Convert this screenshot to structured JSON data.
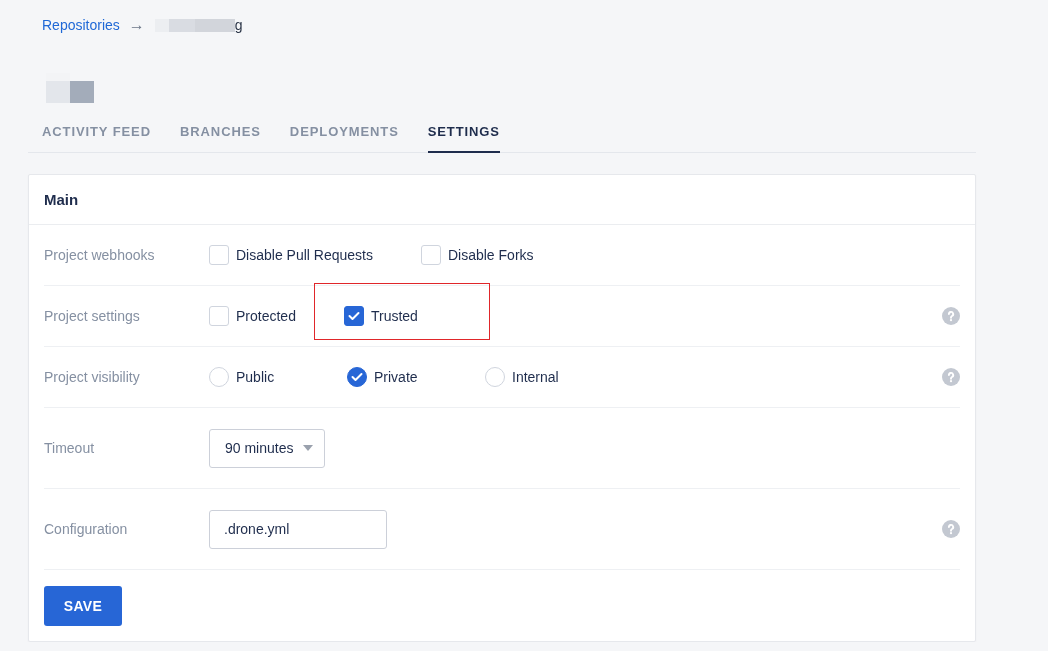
{
  "breadcrumb": {
    "link": "Repositories",
    "separator": "→",
    "repo_name": "g"
  },
  "tabs": [
    {
      "label": "ACTIVITY FEED",
      "selected": false
    },
    {
      "label": "BRANCHES",
      "selected": false
    },
    {
      "label": "DEPLOYMENTS",
      "selected": false
    },
    {
      "label": "SETTINGS",
      "selected": true
    }
  ],
  "card": {
    "title": "Main",
    "rows": [
      {
        "label": "Project webhooks",
        "kind": "checkboxes",
        "help": false,
        "options": [
          {
            "label": "Disable Pull Requests",
            "checked": false,
            "highlighted": false
          },
          {
            "label": "Disable Forks",
            "checked": false,
            "highlighted": false
          }
        ]
      },
      {
        "label": "Project settings",
        "kind": "checkboxes",
        "help": true,
        "options": [
          {
            "label": "Protected",
            "checked": false,
            "highlighted": false
          },
          {
            "label": "Trusted",
            "checked": true,
            "highlighted": true
          }
        ]
      },
      {
        "label": "Project visibility",
        "kind": "radios",
        "help": true,
        "options": [
          {
            "label": "Public",
            "selected": false
          },
          {
            "label": "Private",
            "selected": true
          },
          {
            "label": "Internal",
            "selected": false
          }
        ]
      },
      {
        "label": "Timeout",
        "kind": "select",
        "help": false,
        "value": "90 minutes"
      },
      {
        "label": "Configuration",
        "kind": "input",
        "help": true,
        "value": ".drone.yml"
      }
    ],
    "save_button": "SAVE"
  }
}
